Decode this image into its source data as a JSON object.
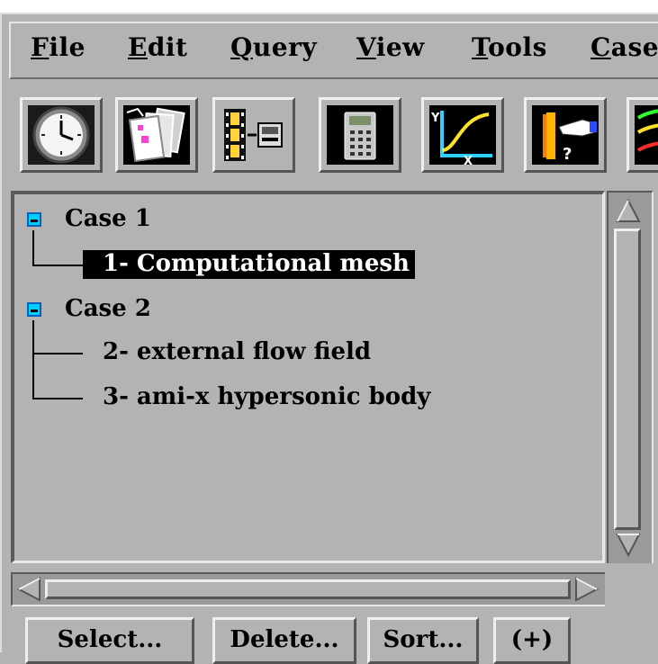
{
  "menu": [
    {
      "key": "F",
      "rest": "ile"
    },
    {
      "key": "E",
      "rest": "dit"
    },
    {
      "key": "Q",
      "rest": "uery"
    },
    {
      "key": "V",
      "rest": "iew"
    },
    {
      "key": "T",
      "rest": "ools"
    },
    {
      "key": "C",
      "rest": "ase"
    }
  ],
  "toolbar": [
    "clock-icon",
    "papers-icon",
    "filmstrip-icon",
    "calculator-icon",
    "xy-plot-icon",
    "query-hand-icon",
    "curves-icon"
  ],
  "tree": {
    "case1": {
      "label": "Case 1",
      "children": [
        "1- Computational mesh"
      ]
    },
    "case2": {
      "label": "Case 2",
      "children": [
        "2- external flow field",
        "3- ami-x hypersonic body"
      ]
    },
    "selected": "1- Computational mesh"
  },
  "buttons": {
    "select": "Select...",
    "delete": "Delete...",
    "sort": "Sort...",
    "expand": "(+)"
  },
  "colors": {
    "panel": "#b3b3b3",
    "toggle": "#00d0ff",
    "selection": "#000000"
  }
}
